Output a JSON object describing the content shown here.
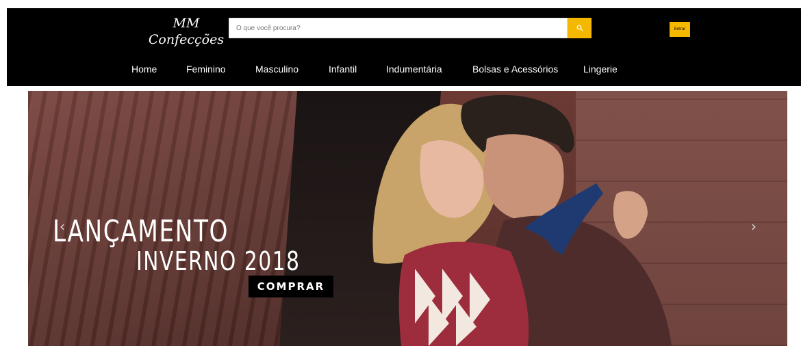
{
  "header": {
    "logo_line1": "MM",
    "logo_line2": "Confecções",
    "search_placeholder": "O que você procura?",
    "login_label": "Entrar"
  },
  "nav": {
    "items": [
      "Home",
      "Feminino",
      "Masculino",
      "Infantil",
      "Indumentária",
      "Bolsas e Acessórios",
      "Lingerie"
    ]
  },
  "banner": {
    "headline_line1": "LANÇAMENTO",
    "headline_line2": "INVERNO 2018",
    "cta_label": "COMPRAR",
    "prev_arrow": "‹",
    "next_arrow": "›"
  },
  "colors": {
    "header_bg": "#000000",
    "accent": "#f5b800",
    "text": "#ffffff"
  },
  "icons": {
    "search": "search-icon",
    "prev": "chevron-left-icon",
    "next": "chevron-right-icon"
  }
}
